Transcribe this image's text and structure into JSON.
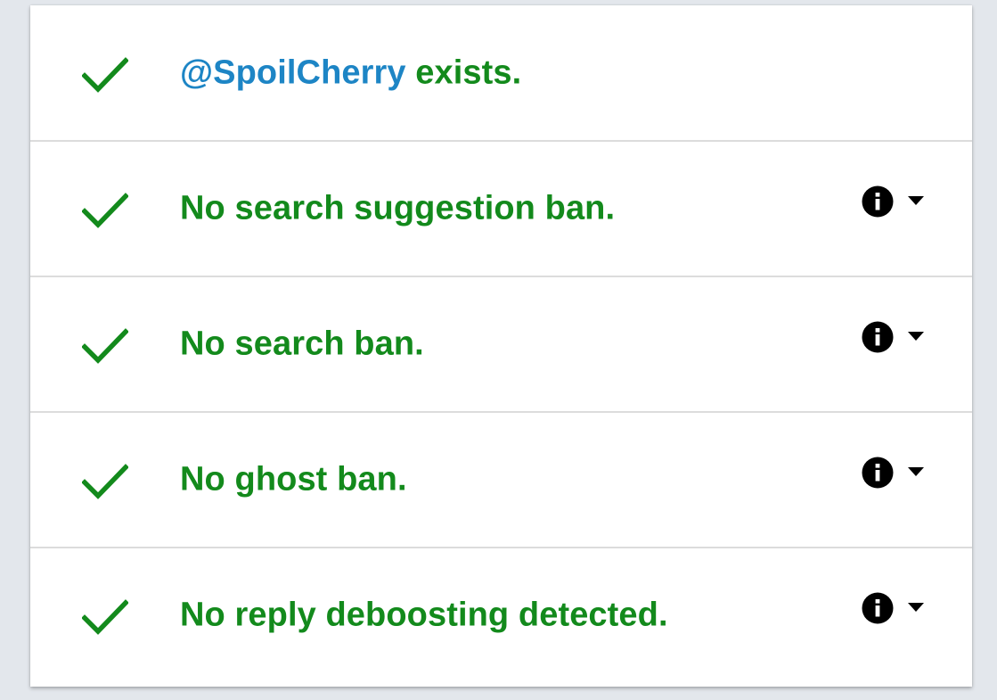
{
  "colors": {
    "success": "#138a1c",
    "link": "#1d85c5",
    "background": "#e3e7ec",
    "card": "#ffffff",
    "icon": "#000000"
  },
  "results": [
    {
      "icon": "check-icon",
      "handle": "@SpoilCherry",
      "text": " exists.",
      "has_controls": false
    },
    {
      "icon": "check-icon",
      "text": "No search suggestion ban.",
      "has_controls": true,
      "controls": [
        "info-icon",
        "caret-down-icon"
      ]
    },
    {
      "icon": "check-icon",
      "text": "No search ban.",
      "has_controls": true,
      "controls": [
        "info-icon",
        "caret-down-icon"
      ]
    },
    {
      "icon": "check-icon",
      "text": "No ghost ban.",
      "has_controls": true,
      "controls": [
        "info-icon",
        "caret-down-icon"
      ]
    },
    {
      "icon": "check-icon",
      "text": "No reply deboosting detected.",
      "has_controls": true,
      "controls": [
        "info-icon",
        "caret-down-icon"
      ]
    }
  ]
}
